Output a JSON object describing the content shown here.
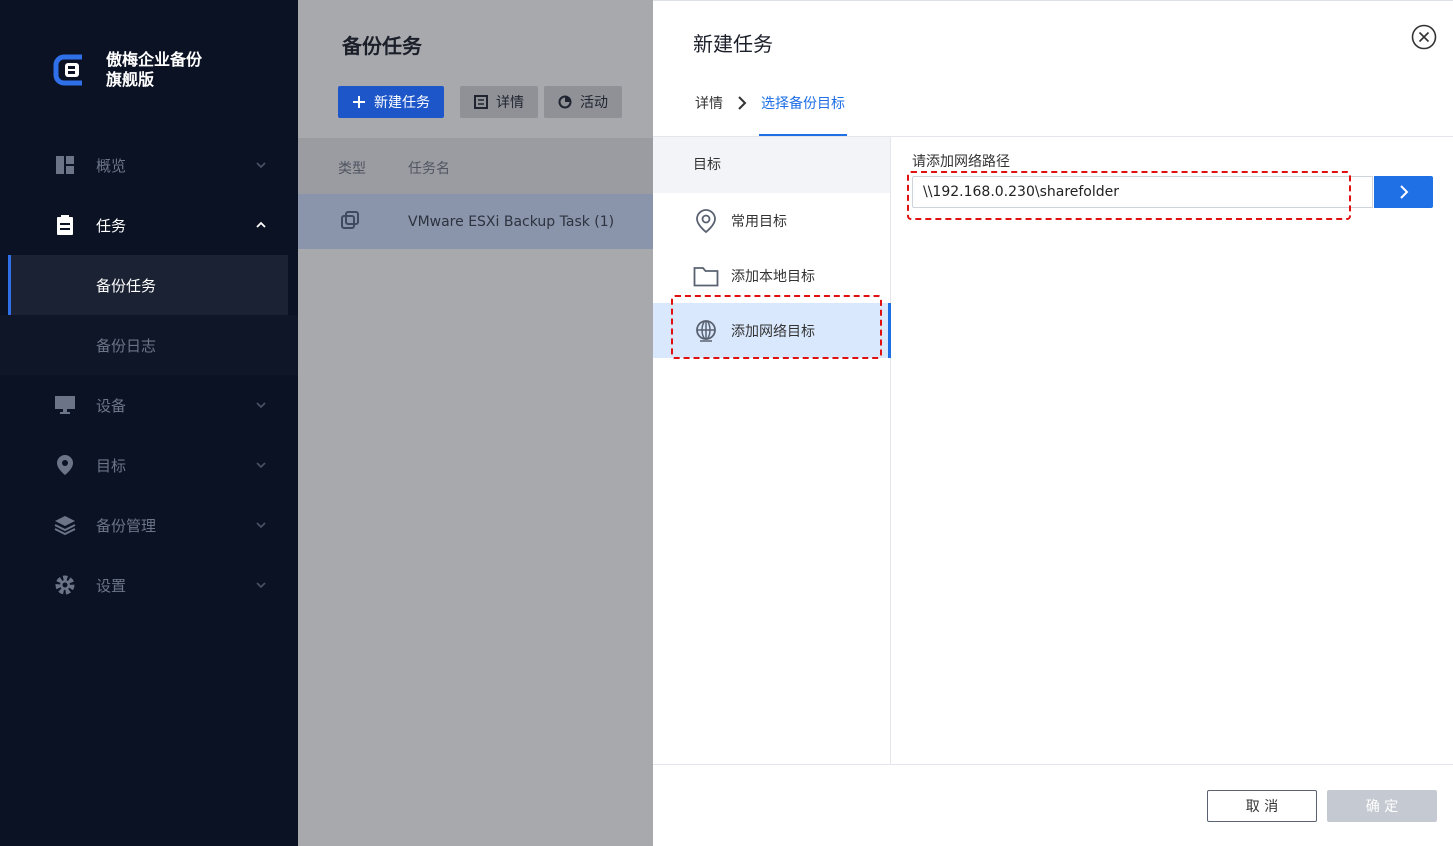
{
  "app": {
    "name_line1": "傲梅企业备份",
    "name_line2": "旗舰版"
  },
  "sidebar": {
    "items": [
      {
        "label": "概览",
        "icon": "dashboard-icon"
      },
      {
        "label": "任务",
        "icon": "clipboard-icon"
      },
      {
        "label": "设备",
        "icon": "monitor-icon"
      },
      {
        "label": "目标",
        "icon": "location-pin-icon"
      },
      {
        "label": "备份管理",
        "icon": "layers-icon"
      },
      {
        "label": "设置",
        "icon": "gear-icon"
      }
    ],
    "task_sub": [
      "备份任务",
      "备份日志"
    ]
  },
  "main": {
    "title": "备份任务",
    "new_task": "新建任务",
    "details": "详情",
    "activity": "活动",
    "col_type": "类型",
    "col_name": "任务名",
    "row_name": "VMware ESXi Backup Task (1)"
  },
  "drawer": {
    "title": "新建任务",
    "crumb_details": "详情",
    "crumb_target": "选择备份目标",
    "left_head": "目标",
    "targets": [
      {
        "label": "常用目标",
        "icon": "location-pin-icon"
      },
      {
        "label": "添加本地目标",
        "icon": "folder-icon"
      },
      {
        "label": "添加网络目标",
        "icon": "globe-icon"
      }
    ],
    "path_label": "请添加网络路径",
    "path_value": "\\\\192.168.0.230\\sharefolder",
    "cancel": "取 消",
    "ok": "确 定"
  },
  "colors": {
    "sidebar_bg": "#0b1224",
    "accent": "#1f6fe5",
    "highlight": "#e01010"
  }
}
